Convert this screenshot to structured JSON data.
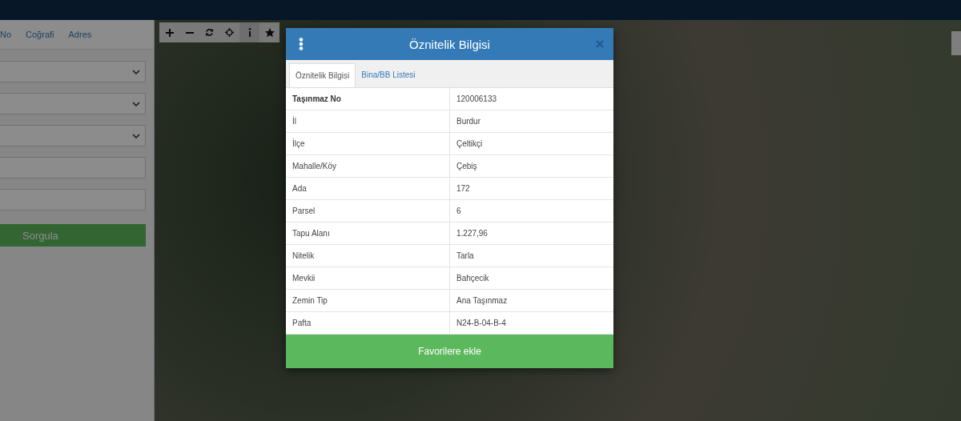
{
  "search_panel": {
    "tabs": [
      {
        "label": "No"
      },
      {
        "label": "Coğrafi"
      },
      {
        "label": "Adres"
      }
    ],
    "fields": [
      {
        "kind": "select"
      },
      {
        "kind": "select"
      },
      {
        "kind": "select"
      },
      {
        "kind": "input"
      },
      {
        "kind": "input"
      }
    ],
    "submit_button": "Sorgula"
  },
  "map_toolbar": [
    {
      "kind": "plus"
    },
    {
      "kind": "minus"
    },
    {
      "kind": "refresh"
    },
    {
      "kind": "crosshair"
    },
    {
      "kind": "info"
    },
    {
      "kind": "star"
    }
  ],
  "dialog": {
    "title": "Öznitelik Bilgisi",
    "tabs": [
      {
        "label": "Öznitelik Bilgisi",
        "selected": true
      },
      {
        "label": "Bina/BB Listesi",
        "selected": false
      }
    ],
    "rows": [
      {
        "label": "Taşınmaz No",
        "value": "120006133",
        "bold": true
      },
      {
        "label": "İl",
        "value": "Burdur",
        "bold": false
      },
      {
        "label": "İlçe",
        "value": "Çeltikçi",
        "bold": false
      },
      {
        "label": "Mahalle/Köy",
        "value": "Çebiş",
        "bold": false
      },
      {
        "label": "Ada",
        "value": "172",
        "bold": false
      },
      {
        "label": "Parsel",
        "value": "6",
        "bold": false
      },
      {
        "label": "Tapu Alanı",
        "value": "1.227,96",
        "bold": false
      },
      {
        "label": "Nitelik",
        "value": "Tarla",
        "bold": false
      },
      {
        "label": "Mevkii",
        "value": "Bahçecik",
        "bold": false
      },
      {
        "label": "Zemin Tip",
        "value": "Ana Taşınmaz",
        "bold": false
      },
      {
        "label": "Pafta",
        "value": "N24-B-04-B-4",
        "bold": false
      }
    ],
    "action_button": "Favorilere ekle"
  }
}
